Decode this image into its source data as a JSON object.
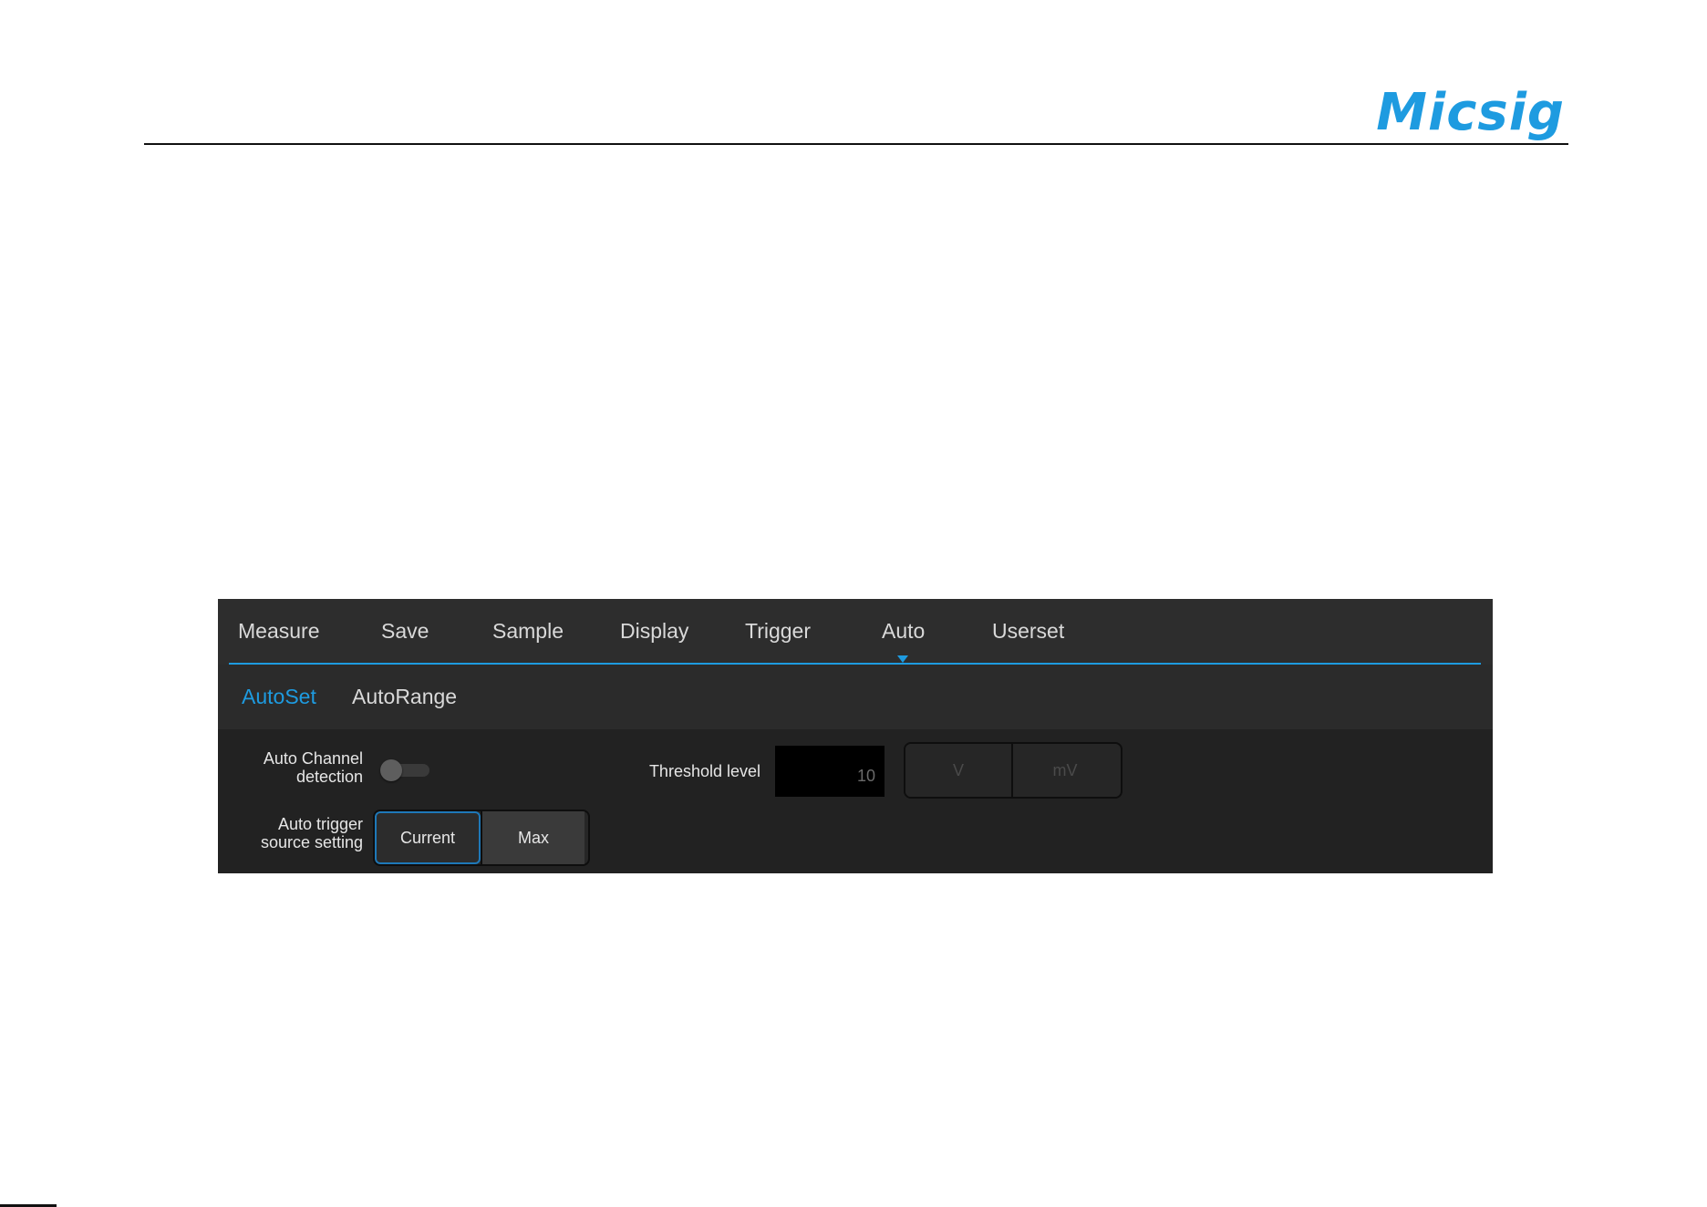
{
  "brand": {
    "logo_text": "Micsig",
    "logo_color": "#1e9be0"
  },
  "tabs": [
    {
      "label": "Measure",
      "active": false
    },
    {
      "label": "Save",
      "active": false
    },
    {
      "label": "Sample",
      "active": false
    },
    {
      "label": "Display",
      "active": false
    },
    {
      "label": "Trigger",
      "active": false
    },
    {
      "label": "Auto",
      "active": true
    },
    {
      "label": "Userset",
      "active": false
    }
  ],
  "subtabs": [
    {
      "label": "AutoSet",
      "active": true
    },
    {
      "label": "AutoRange",
      "active": false
    }
  ],
  "settings": {
    "auto_channel_detection": {
      "label_line1": "Auto Channel",
      "label_line2": "detection",
      "enabled": false
    },
    "threshold_level": {
      "label": "Threshold level",
      "value": "10",
      "units": [
        "V",
        "mV"
      ]
    },
    "auto_trigger_source": {
      "label_line1": "Auto trigger",
      "label_line2": "source setting",
      "options": [
        "Current",
        "Max"
      ],
      "selected": "Current"
    }
  },
  "colors": {
    "accent": "#1e9be0",
    "panel_background": "#2a2a2a"
  }
}
